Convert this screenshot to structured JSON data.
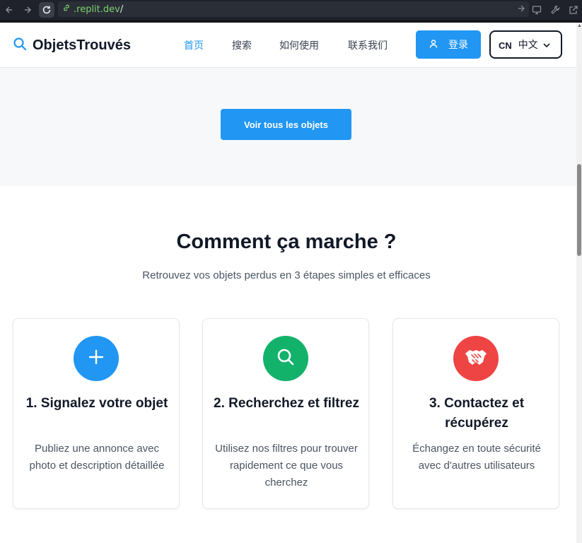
{
  "browser": {
    "url_host": ".replit.dev",
    "url_path": "/"
  },
  "header": {
    "logo_text": "ObjetsTrouvés",
    "nav": [
      {
        "label": "首页",
        "active": true
      },
      {
        "label": "搜索",
        "active": false
      },
      {
        "label": "如何使用",
        "active": false
      },
      {
        "label": "联系我们",
        "active": false
      }
    ],
    "login_label": "登录",
    "language": {
      "code": "CN",
      "label": "中文"
    }
  },
  "hero": {
    "cta_label": "Voir tous les objets"
  },
  "how_it_works": {
    "title": "Comment ça marche ?",
    "subtitle": "Retrouvez vos objets perdus en 3 étapes simples et efficaces",
    "steps": [
      {
        "title": "1. Signalez votre objet",
        "description": "Publiez une annonce avec photo et description détaillée",
        "icon": "plus-icon",
        "color": "#2196f3"
      },
      {
        "title": "2. Recherchez et filtrez",
        "description": "Utilisez nos filtres pour trouver rapidement ce que vous cherchez",
        "icon": "search-icon",
        "color": "#12b26b"
      },
      {
        "title": "3. Contactez et récupérez",
        "description": "Échangez en toute sécurité avec d'autres utilisateurs",
        "icon": "handshake-icon",
        "color": "#ef4444"
      }
    ]
  },
  "colors": {
    "primary": "#2196f3",
    "green": "#12b26b",
    "red": "#ef4444"
  }
}
